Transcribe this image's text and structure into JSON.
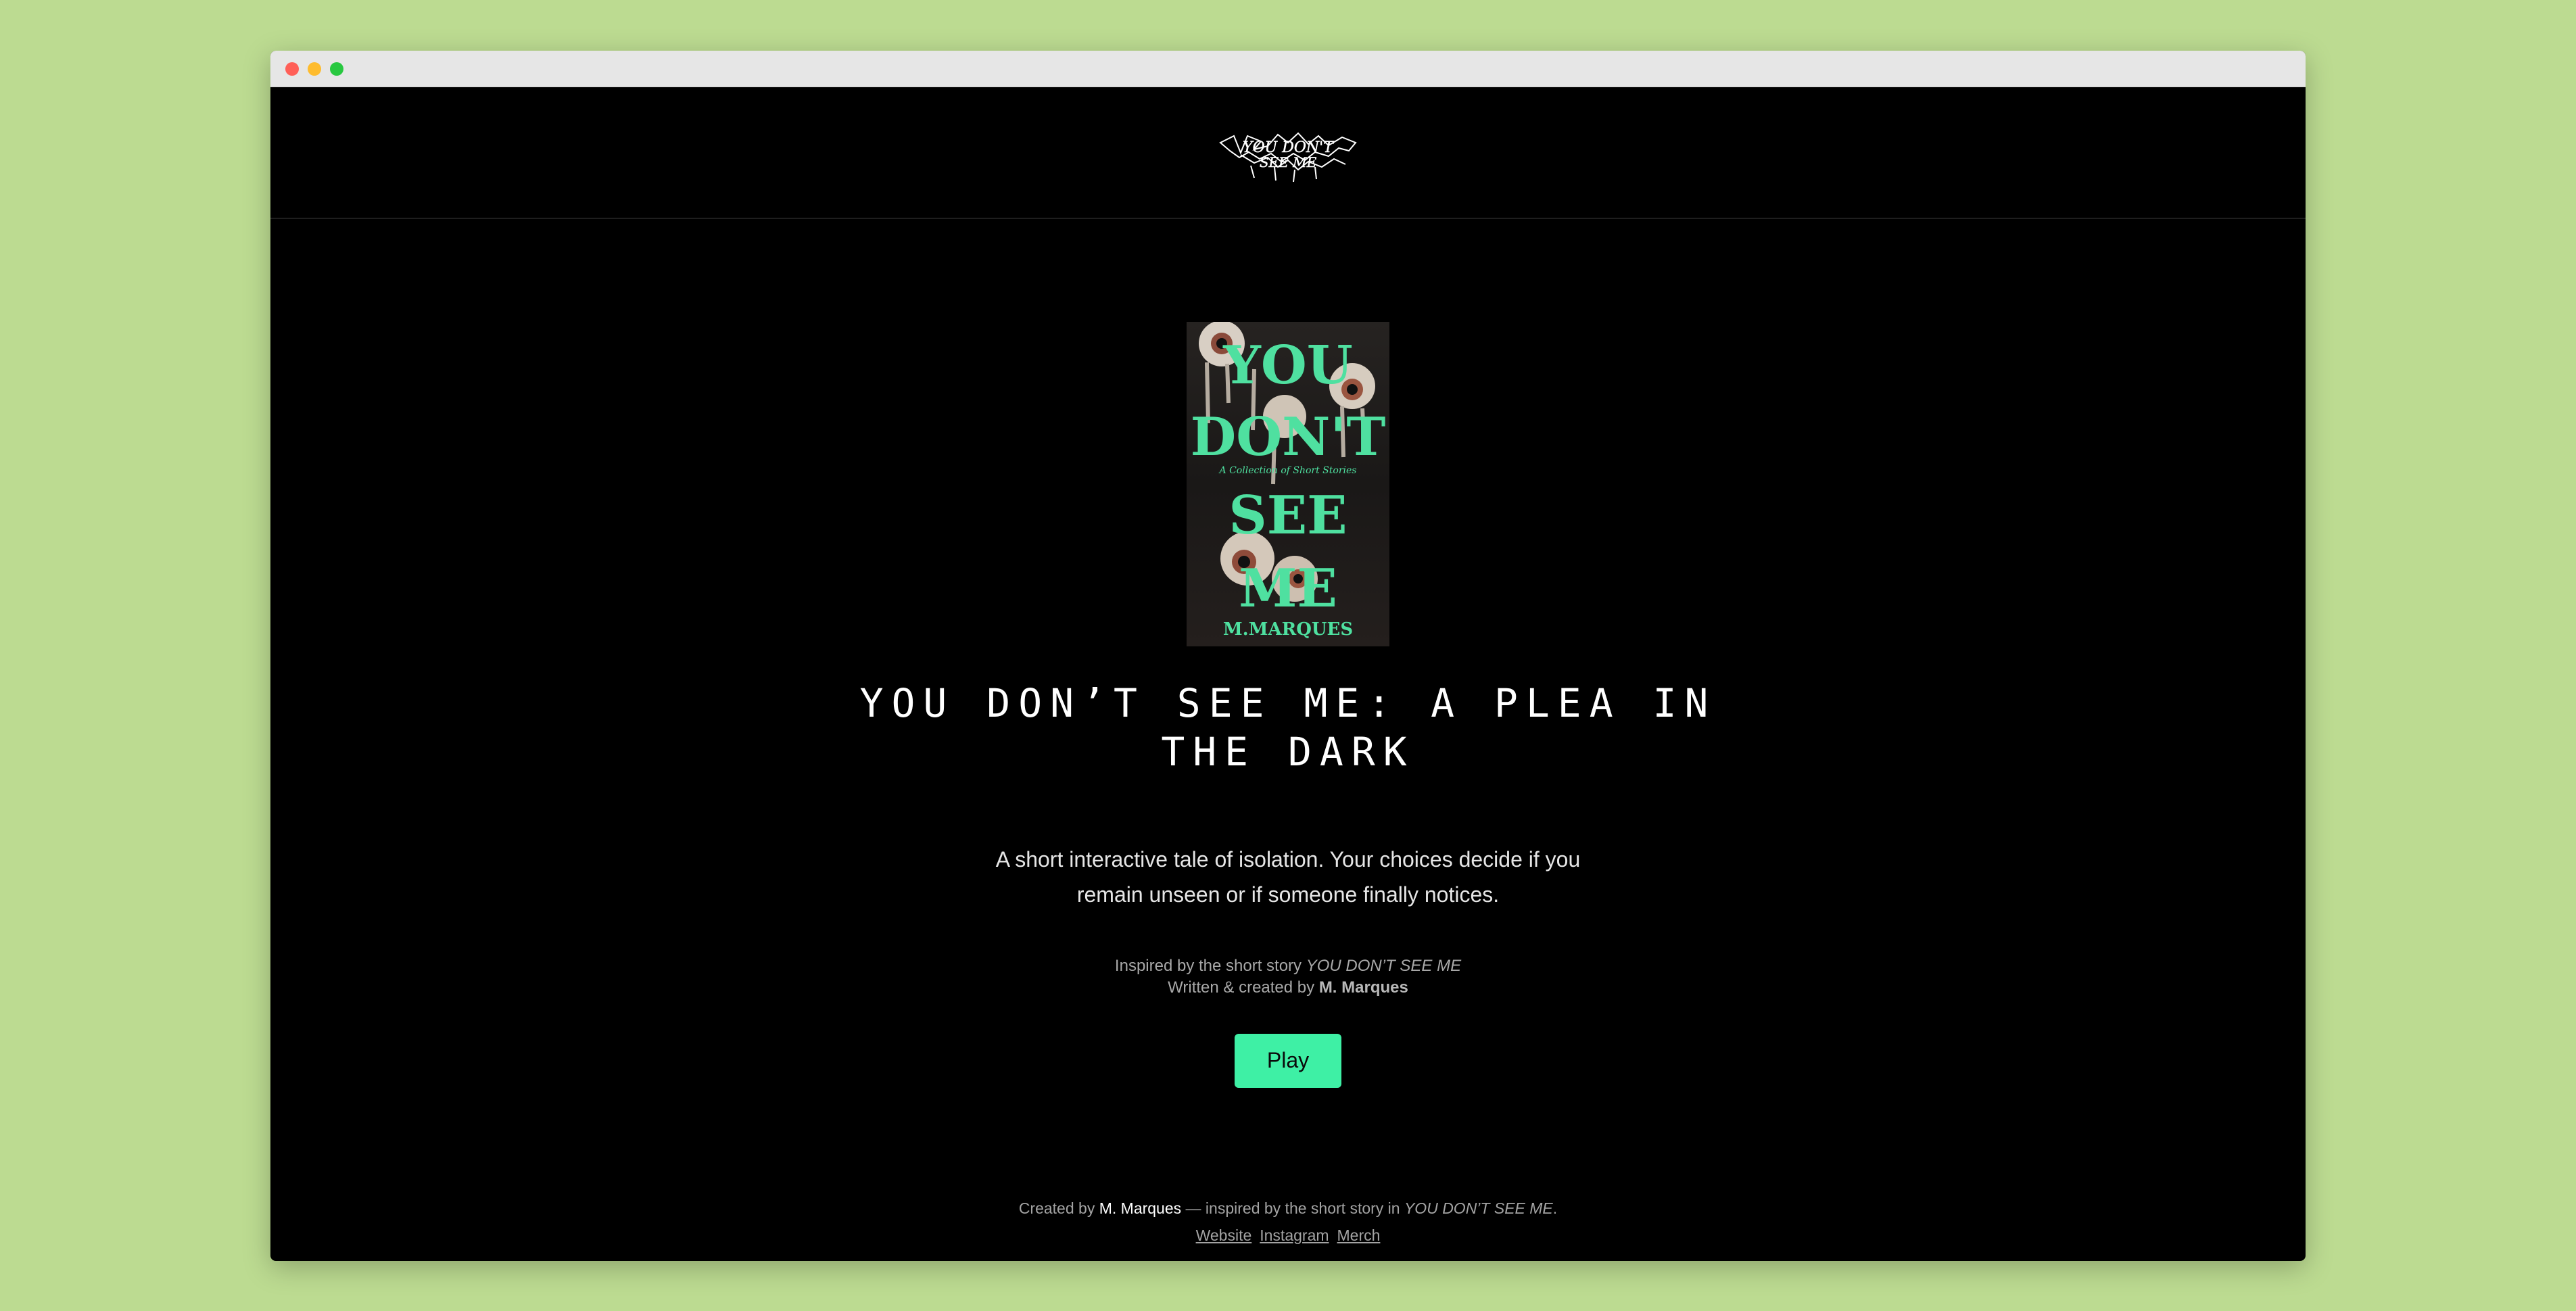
{
  "window": {
    "controls": [
      "close",
      "minimize",
      "maximize"
    ]
  },
  "header": {
    "logo_text": "YOU DON'T SEE ME",
    "logo_icon": "metal-style-logo"
  },
  "cover": {
    "title_lines": [
      "YOU",
      "DON'T",
      "SEE",
      "ME"
    ],
    "subtitle": "A Collection of Short Stories",
    "author": "M.MARQUES",
    "accent_color": "#4fe0a0",
    "image_icon": "eyeballs-cover-art"
  },
  "main": {
    "title": "YOU DON’T SEE ME: A PLEA IN THE DARK",
    "description": "A short interactive tale of isolation. Your choices decide if you remain unseen or if someone finally notices.",
    "inspired_prefix": "Inspired by the short story ",
    "inspired_story": "YOU DON’T SEE ME",
    "written_prefix": "Written & created by ",
    "written_author": "M. Marques",
    "play_label": "Play"
  },
  "footer": {
    "created_prefix": "Created by ",
    "author": "M. Marques",
    "inspired_middle": " — inspired by the short story in ",
    "story": "YOU DON’T SEE ME",
    "period": ".",
    "links": [
      "Website",
      "Instagram",
      "Merch"
    ]
  },
  "colors": {
    "page_background": "#bcdb91",
    "app_background": "#000000",
    "accent": "#3ef0a5"
  }
}
